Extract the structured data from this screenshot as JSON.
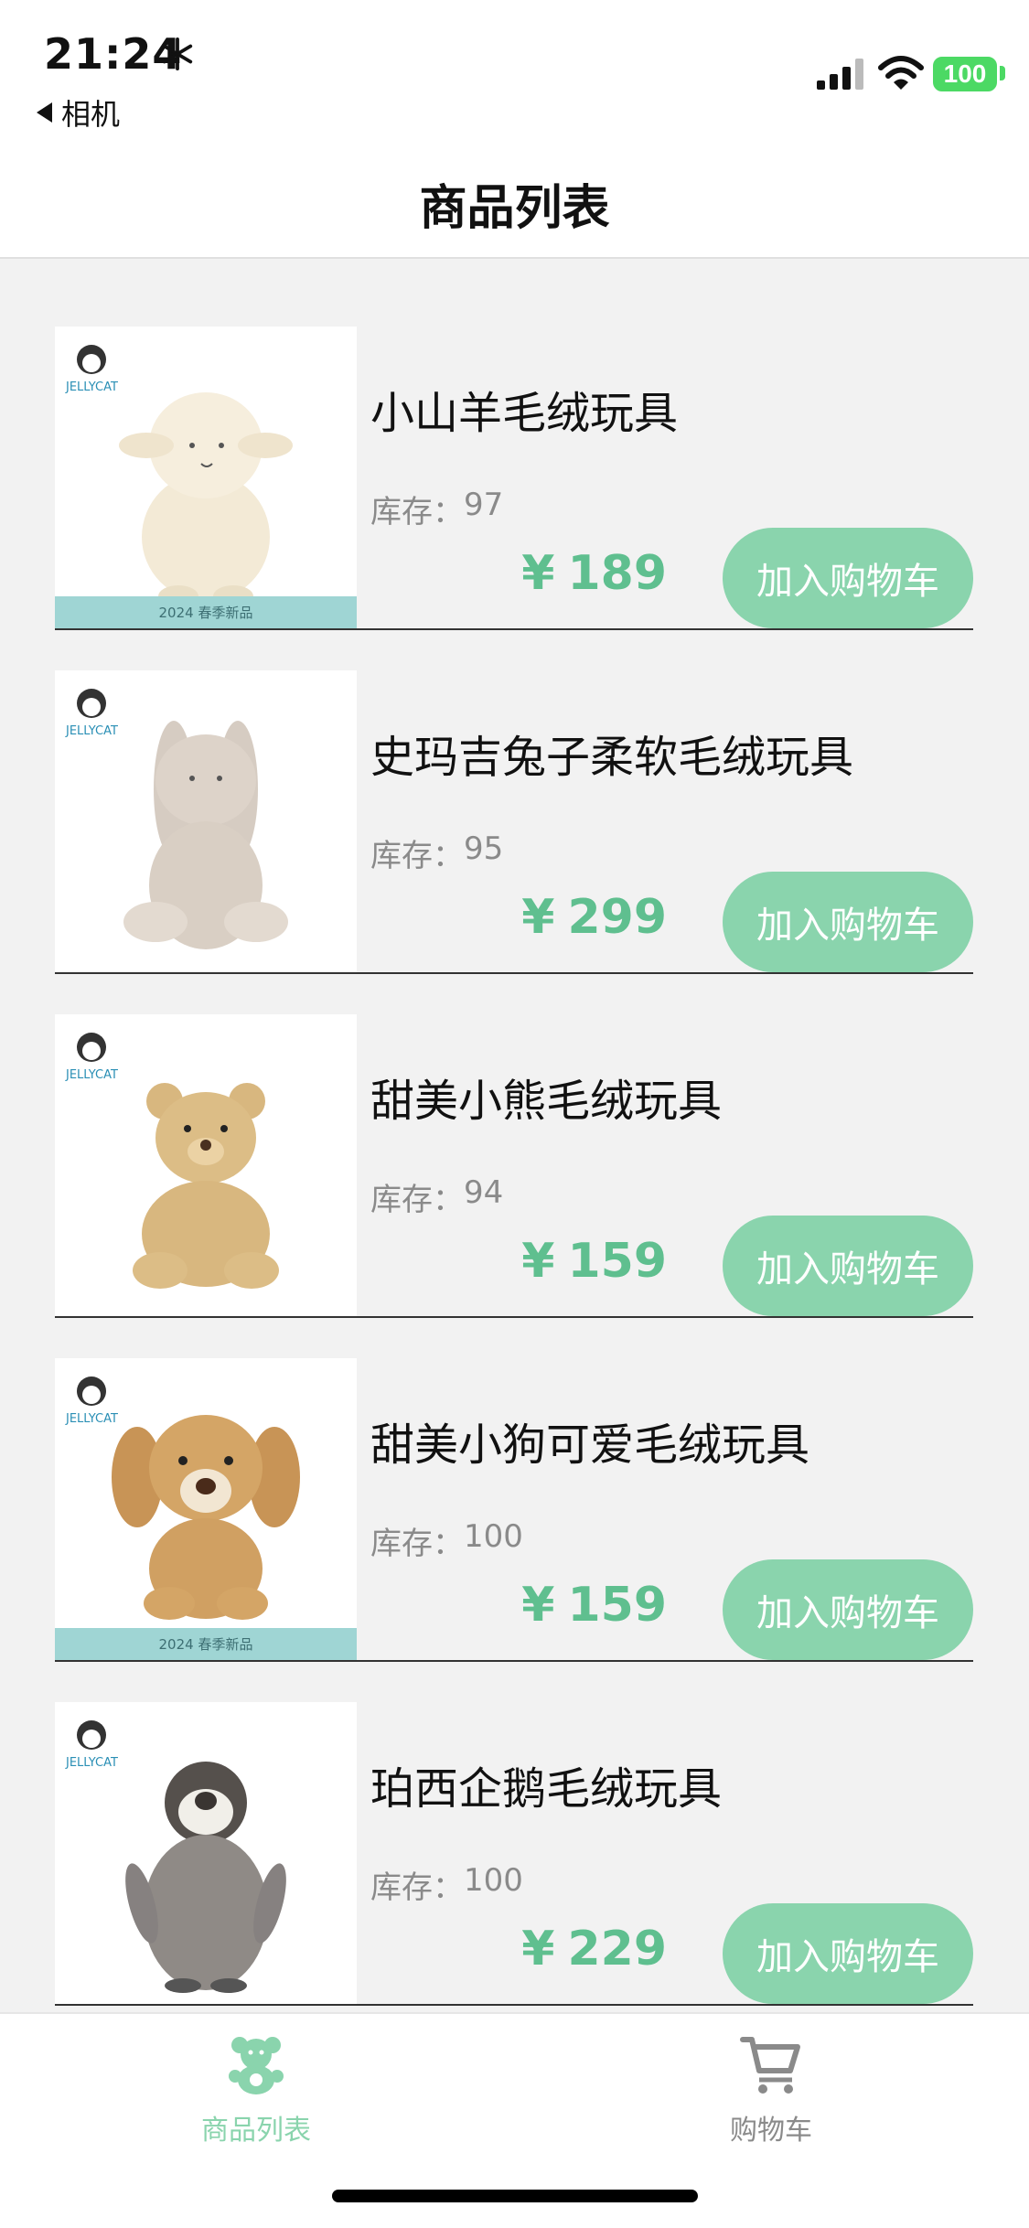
{
  "status": {
    "time": "21:24",
    "back_label": "相机",
    "battery": "100"
  },
  "nav": {
    "title": "商品列表"
  },
  "stock_label": "库存：",
  "currency": "¥",
  "add_cart_label": "加入购物车",
  "products": [
    {
      "name": "小山羊毛绒玩具",
      "stock": "97",
      "price": "189",
      "image": "lamb-plush",
      "banner": "2024 春季新品"
    },
    {
      "name": "史玛吉兔子柔软毛绒玩具",
      "stock": "95",
      "price": "299",
      "image": "bunny-plush"
    },
    {
      "name": "甜美小熊毛绒玩具",
      "stock": "94",
      "price": "159",
      "image": "bear-plush"
    },
    {
      "name": "甜美小狗可爱毛绒玩具",
      "stock": "100",
      "price": "159",
      "image": "puppy-plush",
      "banner": "2024 春季新品"
    },
    {
      "name": "珀西企鹅毛绒玩具",
      "stock": "100",
      "price": "229",
      "image": "penguin-plush"
    }
  ],
  "brand_logo": "JELLYCAT",
  "tabs": [
    {
      "label": "商品列表",
      "icon": "bear-icon",
      "active": true
    },
    {
      "label": "购物车",
      "icon": "cart-icon",
      "active": false
    }
  ],
  "colors": {
    "accent": "#8ad4ad",
    "price": "#5fbf8f",
    "background": "#f2f2f2"
  }
}
